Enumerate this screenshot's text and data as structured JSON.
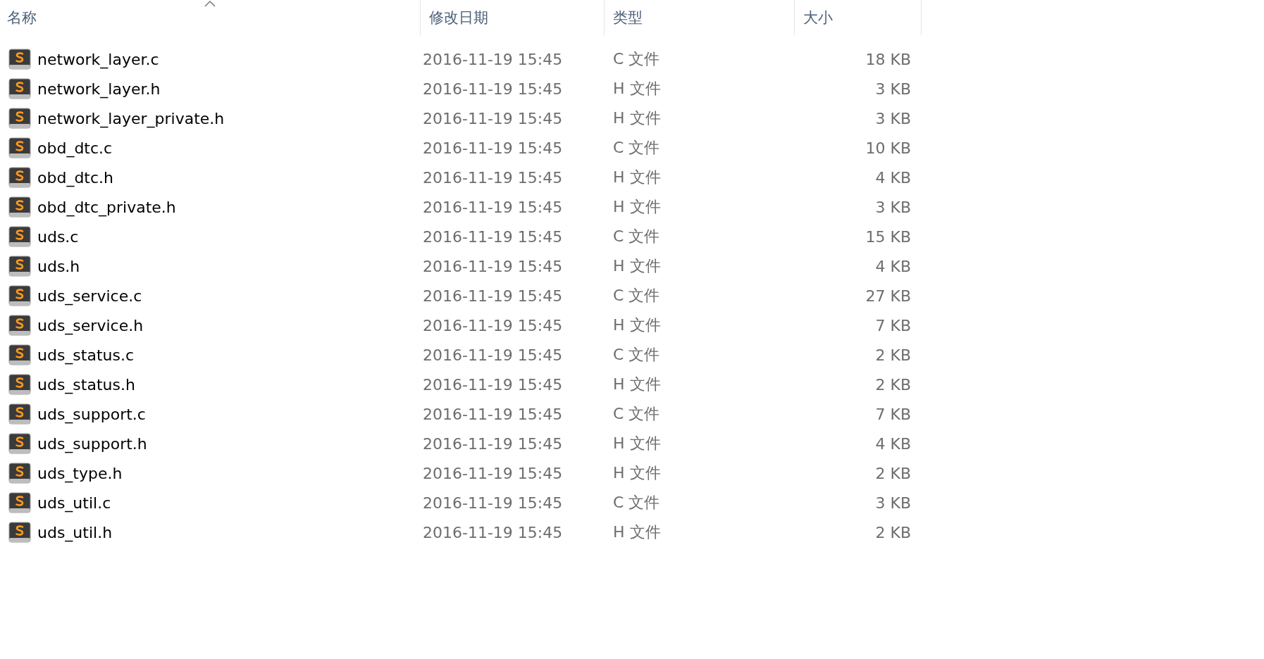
{
  "columns": [
    {
      "label": "名称",
      "sorted": true
    },
    {
      "label": "修改日期",
      "sorted": false
    },
    {
      "label": "类型",
      "sorted": false
    },
    {
      "label": "大小",
      "sorted": false
    }
  ],
  "files": [
    {
      "name": "network_layer.c",
      "modified": "2016-11-19 15:45",
      "type": "C 文件",
      "size": "18 KB"
    },
    {
      "name": "network_layer.h",
      "modified": "2016-11-19 15:45",
      "type": "H 文件",
      "size": "3 KB"
    },
    {
      "name": "network_layer_private.h",
      "modified": "2016-11-19 15:45",
      "type": "H 文件",
      "size": "3 KB"
    },
    {
      "name": "obd_dtc.c",
      "modified": "2016-11-19 15:45",
      "type": "C 文件",
      "size": "10 KB"
    },
    {
      "name": "obd_dtc.h",
      "modified": "2016-11-19 15:45",
      "type": "H 文件",
      "size": "4 KB"
    },
    {
      "name": "obd_dtc_private.h",
      "modified": "2016-11-19 15:45",
      "type": "H 文件",
      "size": "3 KB"
    },
    {
      "name": "uds.c",
      "modified": "2016-11-19 15:45",
      "type": "C 文件",
      "size": "15 KB"
    },
    {
      "name": "uds.h",
      "modified": "2016-11-19 15:45",
      "type": "H 文件",
      "size": "4 KB"
    },
    {
      "name": "uds_service.c",
      "modified": "2016-11-19 15:45",
      "type": "C 文件",
      "size": "27 KB"
    },
    {
      "name": "uds_service.h",
      "modified": "2016-11-19 15:45",
      "type": "H 文件",
      "size": "7 KB"
    },
    {
      "name": "uds_status.c",
      "modified": "2016-11-19 15:45",
      "type": "C 文件",
      "size": "2 KB"
    },
    {
      "name": "uds_status.h",
      "modified": "2016-11-19 15:45",
      "type": "H 文件",
      "size": "2 KB"
    },
    {
      "name": "uds_support.c",
      "modified": "2016-11-19 15:45",
      "type": "C 文件",
      "size": "7 KB"
    },
    {
      "name": "uds_support.h",
      "modified": "2016-11-19 15:45",
      "type": "H 文件",
      "size": "4 KB"
    },
    {
      "name": "uds_type.h",
      "modified": "2016-11-19 15:45",
      "type": "H 文件",
      "size": "2 KB"
    },
    {
      "name": "uds_util.c",
      "modified": "2016-11-19 15:45",
      "type": "C 文件",
      "size": "3 KB"
    },
    {
      "name": "uds_util.h",
      "modified": "2016-11-19 15:45",
      "type": "H 文件",
      "size": "2 KB"
    }
  ]
}
